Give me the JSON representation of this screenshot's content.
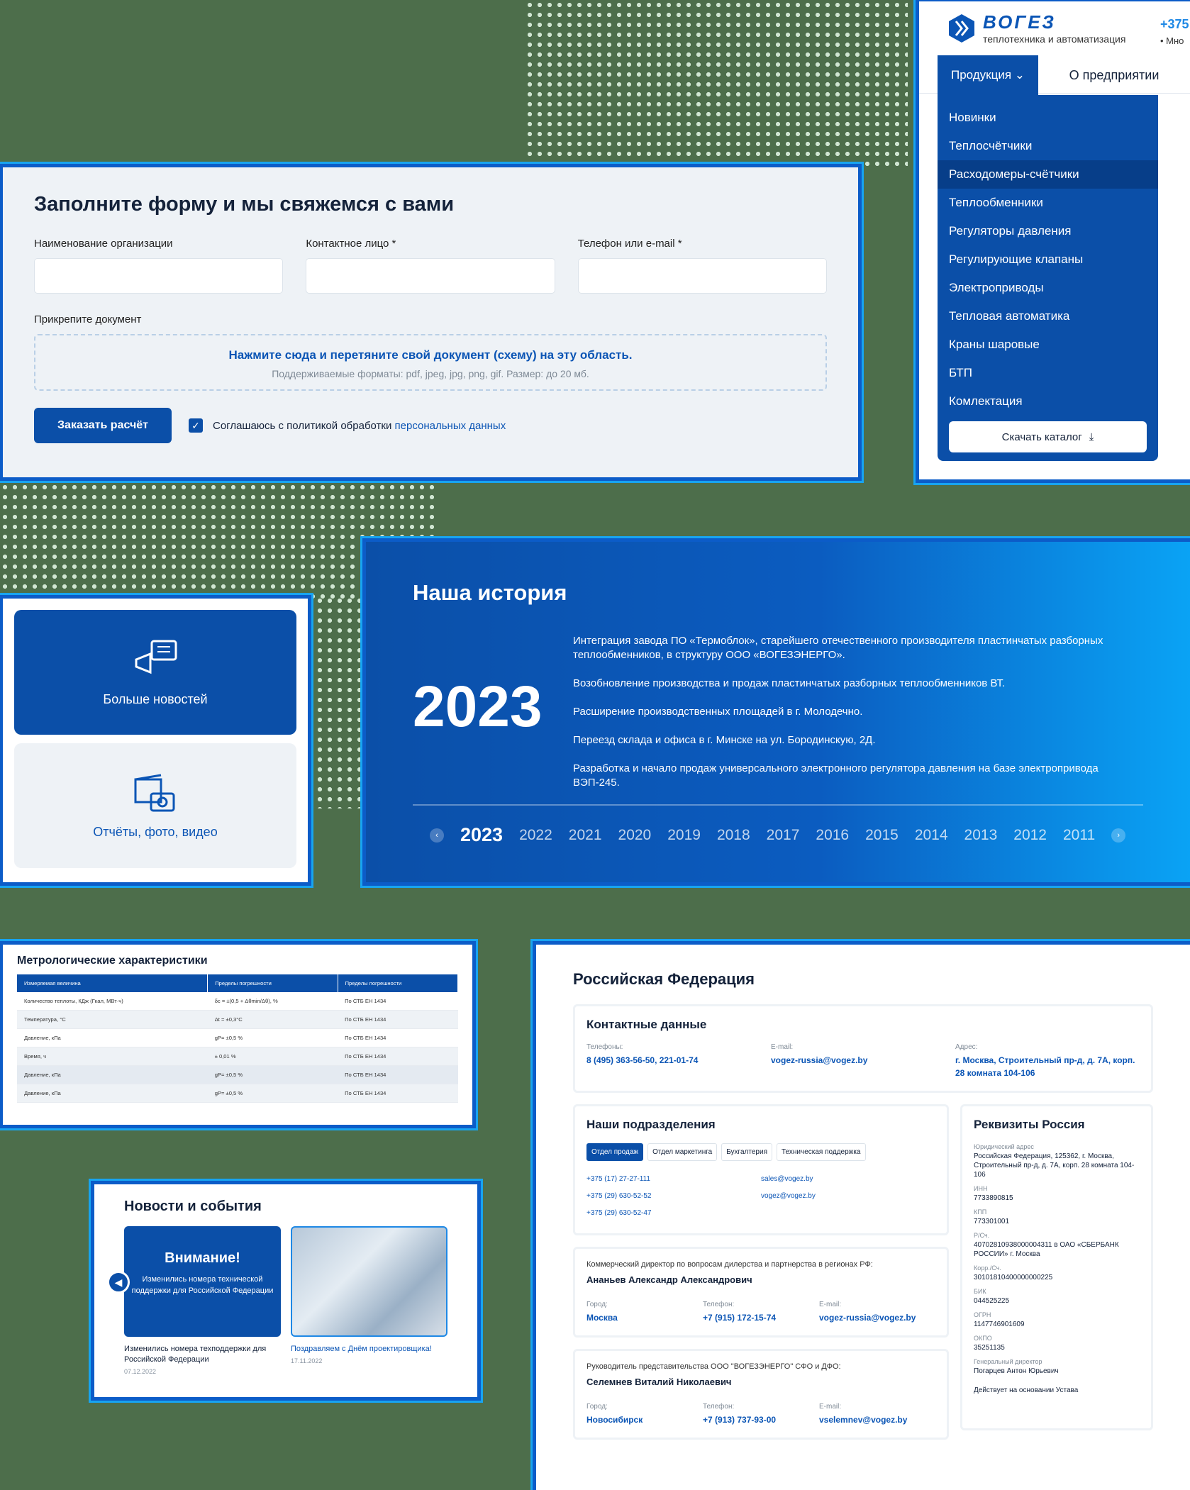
{
  "form": {
    "title": "Заполните форму и мы свяжемся с вами",
    "org_label": "Наименование организации",
    "contact_label": "Контактное лицо *",
    "phone_label": "Телефон или e-mail *",
    "attach_label": "Прикрепите документ",
    "drop_text": "Нажмите сюда и перетяните свой документ (схему) на эту область.",
    "formats": "Поддерживаемые форматы: pdf, jpeg, jpg, png, gif. Размер: до 20 мб.",
    "submit": "Заказать расчёт",
    "agree": "Соглашаюсь с политикой обработки",
    "agree_link": "персональных данных"
  },
  "menu": {
    "brand": "ВОГЕЗ",
    "tagline": "теплотехника и автоматизация",
    "phone": "+375",
    "phone_sub": "• Мно",
    "tab_products": "Продукция",
    "tab_about": "О предприятии",
    "items": [
      "Новинки",
      "Теплосчётчики",
      "Расходомеры-счётчики",
      "Теплообменники",
      "Регуляторы давления",
      "Регулирующие клапаны",
      "Электроприводы",
      "Тепловая автоматика",
      "Краны шаровые",
      "БТП",
      "Комлектация"
    ],
    "download": "Скачать каталог"
  },
  "tiles": {
    "news": "Больше новостей",
    "reports": "Отчёты, фото, видео"
  },
  "history": {
    "title": "Наша история",
    "year": "2023",
    "events": [
      "Интеграция завода ПО «Термоблок», старейшего отечественного производителя пластинчатых разборных теплообменников, в структуру ООО «ВОГЕЗЭНЕРГО».",
      "Возобновление производства и продаж пластинчатых разборных теплообменников ВТ.",
      "Расширение производственных площадей в г. Молодечно.",
      "Переезд склада и офиса в г. Минске на ул. Бородинскую, 2Д.",
      "Разработка и начало продаж универсального электронного регулятора давления на базе электропривода ВЭП-245."
    ],
    "years": [
      "2023",
      "2022",
      "2021",
      "2020",
      "2019",
      "2018",
      "2017",
      "2016",
      "2015",
      "2014",
      "2013",
      "2012",
      "2011"
    ]
  },
  "metro": {
    "title": "Метрологические характеристики",
    "headers": [
      "Измеряемая величина",
      "Пределы погрешности",
      "Пределы погрешности"
    ],
    "rows": [
      [
        "Количество теплоты, КДж (Гкал, МВт·ч)",
        "δc = ±(0,5 + Δθmin/Δθ), %",
        "По СТБ ЕН 1434"
      ],
      [
        "Температура, °С",
        "Δt = ±0,3°С",
        "По СТБ ЕН 1434"
      ],
      [
        "Давление, кПа",
        "gP= ±0,5 %",
        "По СТБ ЕН 1434"
      ],
      [
        "Время, ч",
        "± 0,01 %",
        "По СТБ ЕН 1434"
      ],
      [
        "Давление, кПа",
        "gP= ±0,5 %",
        "По СТБ ЕН 1434"
      ],
      [
        "Давление, кПа",
        "gP= ±0,5 %",
        "По СТБ ЕН 1434"
      ]
    ]
  },
  "news": {
    "title": "Новости и события",
    "card1_head": "Внимание!",
    "card1_body": "Изменились номера технической поддержки для Российской Федерации",
    "card1_title": "Изменились номера техподдержки для Российской Федерации",
    "card1_date": "07.12.2022",
    "card2_title": "Поздравляем с Днём проектировщика!",
    "card2_date": "17.11.2022"
  },
  "contacts": {
    "title": "Российская Федерация",
    "box_title": "Контактные данные",
    "phone_l": "Телефоны:",
    "phone_v": "8 (495) 363-56-50, 221-01-74",
    "email_l": "E-mail:",
    "email_v": "vogez-russia@vogez.by",
    "addr_l": "Адрес:",
    "addr_v": "г. Москва, Строительный пр-д, д. 7А, корп. 28 комната 104-106",
    "divisions_title": "Наши подразделения",
    "div_tabs": [
      "Отдел продаж",
      "Отдел маркетинга",
      "Бухгалтерия",
      "Техническая поддержка"
    ],
    "div_phones": [
      "+375 (17) 27-27-111",
      "+375 (29) 630-52-52",
      "+375 (29) 630-52-47"
    ],
    "div_emails": [
      "sales@vogez.by",
      "vogez@vogez.by"
    ],
    "p1_role": "Коммерческий директор по вопросам дилерства и партнерства в регионах РФ:",
    "p1_name": "Ананьев Александр Александрович",
    "p1_city": "Москва",
    "p1_phone": "+7 (915) 172-15-74",
    "p1_email": "vogez-russia@vogez.by",
    "p2_role": "Руководитель представительства ООО \"ВОГЕЗЭНЕРГО\" СФО и ДФО:",
    "p2_name": "Селемнев Виталий Николаевич",
    "p2_city": "Новосибирск",
    "p2_phone": "+7 (913) 737-93-00",
    "p2_email": "vselemnev@vogez.by",
    "city_l": "Город:",
    "tel_l": "Телефон:",
    "mail_l": "E-mail:",
    "req_title": "Реквизиты Россия",
    "req": [
      {
        "l": "Юридический адрес",
        "v": "Российская Федерация, 125362, г. Москва, Строительный пр-д, д. 7А, корп. 28 комната 104-106"
      },
      {
        "l": "ИНН",
        "v": "7733890815"
      },
      {
        "l": "КПП",
        "v": "773301001"
      },
      {
        "l": "Р/Сч.",
        "v": "40702810938000004311 в ОАО «СБЕРБАНК РОССИИ» г. Москва"
      },
      {
        "l": "Корр./Сч.",
        "v": "30101810400000000225"
      },
      {
        "l": "БИК",
        "v": "044525225"
      },
      {
        "l": "ОГРН",
        "v": "1147746901609"
      },
      {
        "l": "ОКПО",
        "v": "35251135"
      },
      {
        "l": "Генеральный директор",
        "v": "Погарцев Антон Юрьевич"
      }
    ],
    "req_footer": "Действует на основании Устава"
  }
}
